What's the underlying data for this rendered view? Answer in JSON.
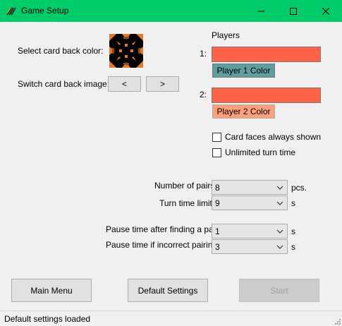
{
  "window": {
    "title": "Game Setup",
    "titlebar_color": "#00cc6a",
    "minimize_icon": "minimize-icon",
    "maximize_icon": "maximize-icon",
    "close_icon": "close-icon"
  },
  "card_back": {
    "color_label": "Select card back color:",
    "switch_label": "Switch card back image:",
    "prev_label": "<",
    "next_label": ">"
  },
  "players": {
    "header": "Players",
    "player1": {
      "index": "1:",
      "color": "#ff6347",
      "button_label": "Player 1 Color",
      "button_color": "#5f9ea0"
    },
    "player2": {
      "index": "2:",
      "color": "#ff6347",
      "button_label": "Player 2 Color",
      "button_color": "#ffa07a"
    }
  },
  "options": {
    "faces_shown_label": "Card faces always shown",
    "faces_shown_checked": false,
    "unlimited_time_label": "Unlimited turn time",
    "unlimited_time_checked": false
  },
  "settings": {
    "pairs_label": "Number of pairs:",
    "pairs_value": "8",
    "pairs_unit": "pcs.",
    "turn_limit_label": "Turn time limit:",
    "turn_limit_value": "9",
    "turn_limit_unit": "s",
    "pause_found_label": "Pause time after finding a pair:",
    "pause_found_value": "1",
    "pause_found_unit": "s",
    "pause_incorrect_label": "Pause time if incorrect pairing:",
    "pause_incorrect_value": "3",
    "pause_incorrect_unit": "s"
  },
  "buttons": {
    "main_menu": "Main Menu",
    "default_settings": "Default Settings",
    "start": "Start"
  },
  "status": {
    "text": "Default settings loaded"
  }
}
